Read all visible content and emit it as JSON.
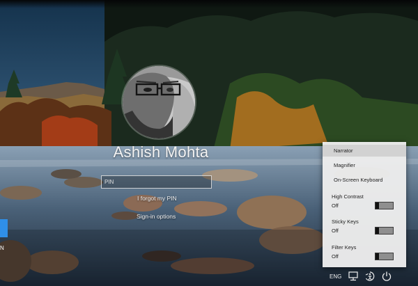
{
  "user": {
    "name": "Ashish Mohta"
  },
  "signin": {
    "pin_placeholder": "PIN",
    "forgot_pin": "I forgot my PIN",
    "signin_options": "Sign-in options"
  },
  "left_edge_text": "N",
  "ease_menu": {
    "narrator": "Narrator",
    "magnifier": "Magnifier",
    "on_screen_keyboard": "On-Screen Keyboard",
    "high_contrast": {
      "label": "High Contrast",
      "state": "Off"
    },
    "sticky_keys": {
      "label": "Sticky Keys",
      "state": "Off"
    },
    "filter_keys": {
      "label": "Filter Keys",
      "state": "Off"
    }
  },
  "tray": {
    "language": "ENG",
    "icons": [
      "network-icon",
      "ease-of-access-icon",
      "power-icon"
    ]
  },
  "colors": {
    "menu_bg": "#ececec",
    "menu_highlight": "#d2d2d2",
    "accent_blue": "#2f8fe8"
  }
}
